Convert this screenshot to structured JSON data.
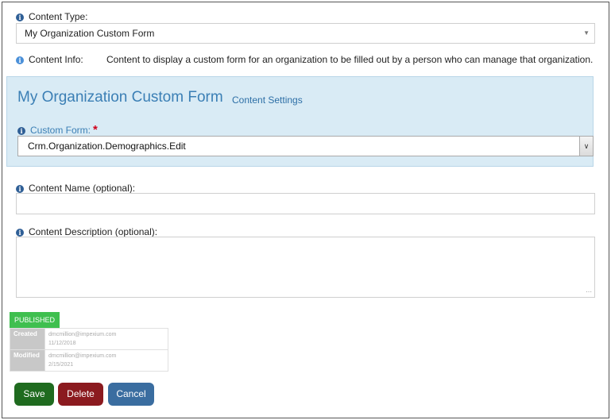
{
  "content_type": {
    "label": "Content Type:",
    "value": "My Organization Custom Form"
  },
  "content_info": {
    "label": "Content Info:",
    "text": "Content to display a custom form for an organization to be filled out by a person who can manage that organization."
  },
  "panel": {
    "title": "My Organization Custom Form",
    "settings_link": "Content Settings",
    "custom_form_label": "Custom Form:",
    "required_mark": "*",
    "custom_form_value": "Crm.Organization.Demographics.Edit"
  },
  "content_name": {
    "label": "Content Name (optional):",
    "value": ""
  },
  "content_description": {
    "label": "Content Description (optional):",
    "value": ""
  },
  "status": {
    "badge": "PUBLISHED",
    "created_label": "Created",
    "created_user": "dmcmillion@impexium.com",
    "created_date": "11/12/2018",
    "modified_label": "Modified",
    "modified_user": "dmcmillion@impexium.com",
    "modified_date": "2/15/2021"
  },
  "buttons": {
    "save": "Save",
    "delete": "Delete",
    "cancel": "Cancel"
  },
  "colors": {
    "panel_bg": "#d9ebf5",
    "accent": "#3b7fb5",
    "save": "#1f6b1f",
    "delete": "#8b1a1f",
    "cancel": "#3a6da0",
    "published": "#3fbf4f"
  }
}
